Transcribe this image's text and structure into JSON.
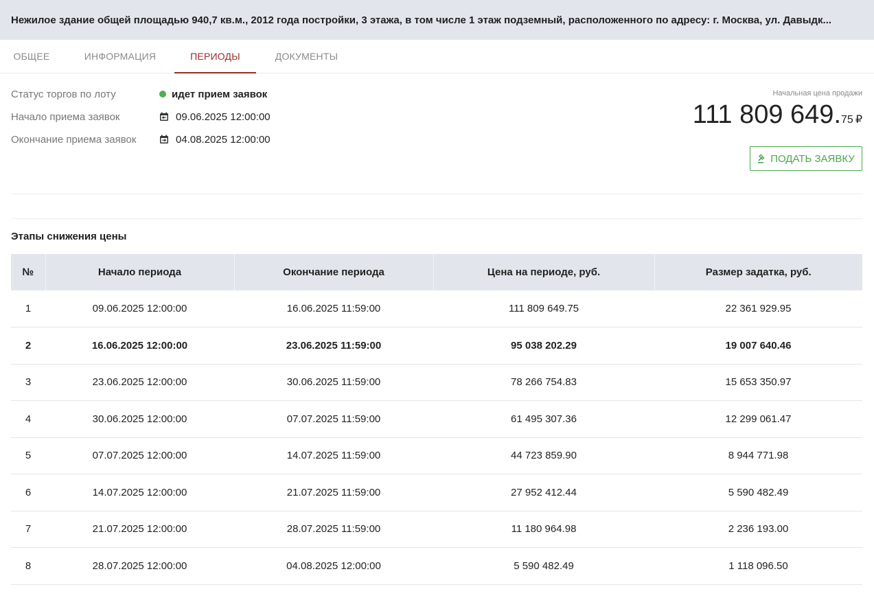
{
  "header": {
    "title": "Нежилое здание общей площадью 940,7 кв.м., 2012 года постройки, 3 этажа, в том числе 1 этаж подземный, расположенного по адресу: г. Москва, ул. Давыдк..."
  },
  "tabs": [
    {
      "label": "ОБЩЕЕ",
      "active": false
    },
    {
      "label": "ИНФОРМАЦИЯ",
      "active": false
    },
    {
      "label": "ПЕРИОДЫ",
      "active": true
    },
    {
      "label": "ДОКУМЕНТЫ",
      "active": false
    }
  ],
  "status": {
    "status_label": "Статус торгов по лоту",
    "status_value": "идет прием заявок",
    "start_label": "Начало приема заявок",
    "start_value": "09.06.2025 12:00:00",
    "end_label": "Окончание приема заявок",
    "end_value": "04.08.2025 12:00:00"
  },
  "price": {
    "caption": "Начальная цена продажи",
    "main": "111 809 649.",
    "kopecks": "75",
    "currency": "₽"
  },
  "apply_button": {
    "label": "ПОДАТЬ ЗАЯВКУ"
  },
  "periods": {
    "title": "Этапы снижения цены",
    "columns": [
      "№",
      "Начало периода",
      "Окончание периода",
      "Цена на периоде, руб.",
      "Размер задатка, руб."
    ],
    "rows": [
      [
        "1",
        "09.06.2025 12:00:00",
        "16.06.2025 11:59:00",
        "111 809 649.75",
        "22 361 929.95"
      ],
      [
        "2",
        "16.06.2025 12:00:00",
        "23.06.2025 11:59:00",
        "95 038 202.29",
        "19 007 640.46"
      ],
      [
        "3",
        "23.06.2025 12:00:00",
        "30.06.2025 11:59:00",
        "78 266 754.83",
        "15 653 350.97"
      ],
      [
        "4",
        "30.06.2025 12:00:00",
        "07.07.2025 11:59:00",
        "61 495 307.36",
        "12 299 061.47"
      ],
      [
        "5",
        "07.07.2025 12:00:00",
        "14.07.2025 11:59:00",
        "44 723 859.90",
        "8 944 771.98"
      ],
      [
        "6",
        "14.07.2025 12:00:00",
        "21.07.2025 11:59:00",
        "27 952 412.44",
        "5 590 482.49"
      ],
      [
        "7",
        "21.07.2025 12:00:00",
        "28.07.2025 11:59:00",
        "11 180 964.98",
        "2 236 193.00"
      ],
      [
        "8",
        "28.07.2025 12:00:00",
        "04.08.2025 12:00:00",
        "5 590 482.49",
        "1 118 096.50"
      ]
    ],
    "current_row": 2
  },
  "colors": {
    "accent": "#9c2a26",
    "status_green": "#4aa64d",
    "header_bg": "#e2e6ec"
  },
  "icons": {
    "status": "status-dot-icon",
    "start_date": "calendar-start-icon",
    "end_date": "calendar-end-icon",
    "apply": "gavel-icon"
  }
}
